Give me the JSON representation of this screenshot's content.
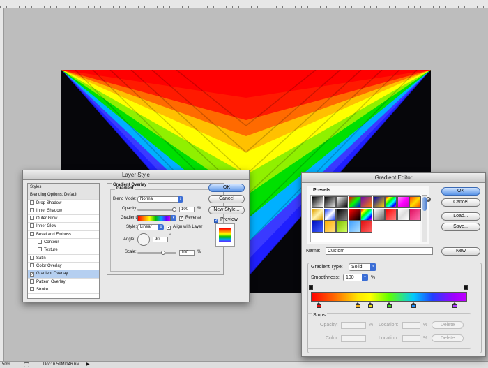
{
  "status": {
    "zoom": "50%",
    "doc": "Doc: 6.59M/146.6M"
  },
  "layer_style": {
    "title": "Layer Style",
    "styles": [
      {
        "label": "Styles",
        "kind": "head"
      },
      {
        "label": "Blending Options: Default",
        "kind": "head"
      },
      {
        "label": "Drop Shadow",
        "checked": false
      },
      {
        "label": "Inner Shadow",
        "checked": false
      },
      {
        "label": "Outer Glow",
        "checked": false
      },
      {
        "label": "Inner Glow",
        "checked": false
      },
      {
        "label": "Bevel and Emboss",
        "checked": false
      },
      {
        "label": "Contour",
        "checked": false,
        "indent": true
      },
      {
        "label": "Texture",
        "checked": false,
        "indent": true
      },
      {
        "label": "Satin",
        "checked": false
      },
      {
        "label": "Color Overlay",
        "checked": false
      },
      {
        "label": "Gradient Overlay",
        "checked": true,
        "selected": true
      },
      {
        "label": "Pattern Overlay",
        "checked": false
      },
      {
        "label": "Stroke",
        "checked": false
      }
    ],
    "section_title": "Gradient Overlay",
    "group_title": "Gradient",
    "blend_mode_label": "Blend Mode:",
    "blend_mode_value": "Normal",
    "opacity_label": "Opacity:",
    "opacity_value": "100",
    "opacity_percent": 100,
    "gradient_label": "Gradient:",
    "reverse_label": "Reverse",
    "style_label": "Style:",
    "style_value": "Linear",
    "align_label": "Align with Layer",
    "angle_label": "Angle:",
    "angle_value": "90",
    "angle_unit": "°",
    "scale_label": "Scale:",
    "scale_value": "100",
    "percent": "%",
    "buttons": {
      "ok": "OK",
      "cancel": "Cancel",
      "new_style": "New Style..."
    },
    "preview_label": "Preview"
  },
  "gradient_editor": {
    "title": "Gradient Editor",
    "presets_label": "Presets",
    "buttons": {
      "ok": "OK",
      "cancel": "Cancel",
      "load": "Load...",
      "save": "Save...",
      "new": "New",
      "delete": "Delete"
    },
    "name_label": "Name:",
    "name_value": "Custom",
    "gradient_type_label": "Gradient Type:",
    "gradient_type_value": "Solid",
    "smoothness_label": "Smoothness:",
    "smoothness_value": "100",
    "percent": "%",
    "stops_label": "Stops",
    "opacity_label": "Opacity:",
    "color_label": "Color:",
    "location_label": "Location:",
    "color_stops": [
      {
        "color": "#e01010",
        "pos": 0.05
      },
      {
        "color": "#f0b020",
        "pos": 0.3
      },
      {
        "color": "#f0e020",
        "pos": 0.38
      },
      {
        "color": "#40d020",
        "pos": 0.5
      },
      {
        "color": "#2090ff",
        "pos": 0.66
      },
      {
        "color": "#b040ff",
        "pos": 0.92
      }
    ],
    "preset_swatches": [
      "linear-gradient(135deg,#000,#fff)",
      "linear-gradient(135deg,#000,#eee)",
      "linear-gradient(135deg,#fff,#000)",
      "linear-gradient(135deg,#ff0000,#00ff00,#0000ff)",
      "linear-gradient(135deg,#6a0dad,#ff8000)",
      "linear-gradient(135deg,#00a,#ffd400)",
      "linear-gradient(135deg,#f00,#ff0,#0f0,#0ff,#00f,#f0f)",
      "linear-gradient(135deg,#f8f,#f0f,#c0c)",
      "linear-gradient(135deg,#ff4000,#ffe000,#ff4000)",
      "linear-gradient(135deg,#dfa000,#fff4b0,#dfa000)",
      "linear-gradient(135deg,#1a40ff,#fff,#1a40ff)",
      "linear-gradient(135deg,#000,#888)",
      "linear-gradient(135deg,#ff0000,#000)",
      "linear-gradient(135deg,#f00,#ff0,#0f0,#0ff,#00f,#f0f)",
      "linear-gradient(135deg,#fff,#666)",
      "linear-gradient(135deg,#ff0000,#ff8080)",
      "linear-gradient(135deg,#fff,#ddd,#fff)",
      "linear-gradient(135deg,#e01060,#ff70b0)",
      "linear-gradient(135deg,#0010c0,#4060ff)",
      "linear-gradient(135deg,#ffb000,#ffe080)",
      "linear-gradient(135deg,#80c000,#d0ff60)",
      "linear-gradient(135deg,#40a0ff,#b0e0ff)",
      "linear-gradient(135deg,#e01010,#ff6060)"
    ]
  }
}
